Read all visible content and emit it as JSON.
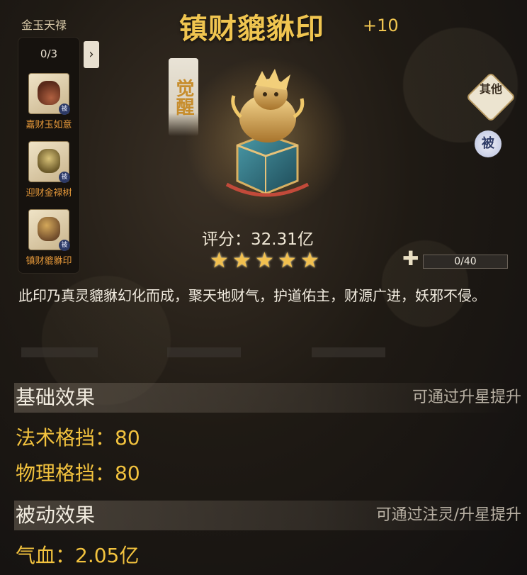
{
  "set": {
    "title": "金玉天禄",
    "count": "0/3",
    "toggle_icon": "arrow-right-icon",
    "items": [
      {
        "label": "嘉财玉如意",
        "tag": "被"
      },
      {
        "label": "迎财金禄树",
        "tag": "被"
      },
      {
        "label": "镇财貔貅印",
        "tag": "被"
      }
    ]
  },
  "item": {
    "name": "镇财貔貅印",
    "level": "+10",
    "awaken": "觉醒",
    "score": "评分：32.31亿",
    "stars": 5
  },
  "side": {
    "other_label": "其他",
    "passive_label": "被"
  },
  "fragments": {
    "progress": "0/40",
    "fraction": 0
  },
  "description": "此印乃真灵貔貅幻化而成，聚天地财气，护道佑主，财源广进，妖邪不侵。",
  "basic": {
    "title": "基础效果",
    "hint": "可通过升星提升",
    "stats": [
      "法术格挡：80",
      "物理格挡：80"
    ]
  },
  "passive": {
    "title": "被动效果",
    "hint": "可通过注灵/升星提升",
    "stats": [
      "气血：2.05亿"
    ]
  },
  "colors": {
    "title_gold": "#f0c550",
    "stat_gold": "#f2c23e",
    "set_label_orange": "#e89a3a"
  }
}
